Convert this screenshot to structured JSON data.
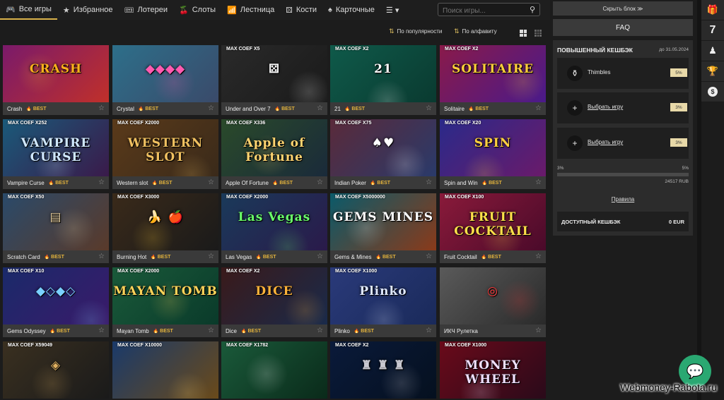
{
  "nav": {
    "items": [
      {
        "label": "Все игры",
        "icon": "gamepad-icon",
        "glyph": "🎮",
        "active": true
      },
      {
        "label": "Избранное",
        "icon": "star-icon",
        "glyph": "★"
      },
      {
        "label": "Лотереи",
        "icon": "ticket-icon",
        "glyph": "🎟"
      },
      {
        "label": "Слоты",
        "icon": "cherry-icon",
        "glyph": "🍒"
      },
      {
        "label": "Лестница",
        "icon": "ladder-icon",
        "glyph": "📶"
      },
      {
        "label": "Кости",
        "icon": "dice-icon",
        "glyph": "⚄"
      },
      {
        "label": "Карточные",
        "icon": "spade-icon",
        "glyph": "♠"
      }
    ],
    "more_glyph": "☰ ▾"
  },
  "search": {
    "placeholder": "Поиск игры...",
    "icon": "search-icon"
  },
  "sort": {
    "popular": "По популярности",
    "alphabet": "По алфавиту"
  },
  "games": [
    {
      "name": "Crash",
      "best": "BEST",
      "coef": "",
      "art": "CRASH",
      "bg": "#7a1a6a",
      "bg2": "#c0302a",
      "color": "#ffb21c"
    },
    {
      "name": "Crystal",
      "best": "BEST",
      "coef": "",
      "art": "◆◆◆◆",
      "bg": "#2d6f8a",
      "bg2": "#3a4a6a",
      "color": "#ff5ab0"
    },
    {
      "name": "Under and Over 7",
      "best": "BEST",
      "coef": "MAX COEF X5",
      "art": "⚄",
      "bg": "#2a2a2a",
      "bg2": "#1a1a1a",
      "color": "#f4f4f4"
    },
    {
      "name": "21",
      "best": "BEST",
      "coef": "MAX COEF X2",
      "art": "21",
      "bg": "#0f5a4a",
      "bg2": "#0a3a30",
      "color": "#ffffff"
    },
    {
      "name": "Solitaire",
      "best": "BEST",
      "coef": "MAX COEF X2",
      "art": "SOLITAIRE",
      "bg": "#8a1a4a",
      "bg2": "#4a1a8a",
      "color": "#ffcf3a"
    },
    {
      "name": "Vampire Curse",
      "best": "BEST",
      "coef": "MAX COEF X252",
      "art": "VAMPIRE CURSE",
      "bg": "#1a5a7a",
      "bg2": "#3a1a4a",
      "color": "#d0e8ff"
    },
    {
      "name": "Western slot",
      "best": "BEST",
      "coef": "MAX COEF X2000",
      "art": "WESTERN SLOT",
      "bg": "#5a3a1a",
      "bg2": "#3a2a1a",
      "color": "#f0c060"
    },
    {
      "name": "Apple Of Fortune",
      "best": "BEST",
      "coef": "MAX COEF X336",
      "art": "Apple of Fortune",
      "bg": "#2a4a2a",
      "bg2": "#1a2a3a",
      "color": "#ffd470"
    },
    {
      "name": "Indian Poker",
      "best": "BEST",
      "coef": "MAX COEF X75",
      "art": "♠♥",
      "bg": "#5a2a3a",
      "bg2": "#2a3a6a",
      "color": "#ffffff"
    },
    {
      "name": "Spin and Win",
      "best": "BEST",
      "coef": "MAX COEF X20",
      "art": "SPIN",
      "bg": "#2a2a8a",
      "bg2": "#6a1a6a",
      "color": "#ffd040"
    },
    {
      "name": "Scratch Card",
      "best": "BEST",
      "coef": "MAX COEF X50",
      "art": "▤",
      "bg": "#2a4a6a",
      "bg2": "#5a3a2a",
      "color": "#e8d0a0"
    },
    {
      "name": "Burning Hot",
      "best": "BEST",
      "coef": "MAX COEF X3000",
      "art": "🍌 🍎",
      "bg": "#3a2a1a",
      "bg2": "#1a1a1a",
      "color": "#ffcc33"
    },
    {
      "name": "Las Vegas",
      "best": "BEST",
      "coef": "MAX COEF X2000",
      "art": "Las Vegas",
      "bg": "#1a3a5a",
      "bg2": "#2a1a4a",
      "color": "#6aff6a"
    },
    {
      "name": "Gems & Mines",
      "best": "BEST",
      "coef": "MAX COEF X5000000",
      "art": "GEMS MINES",
      "bg": "#0a5a6a",
      "bg2": "#8a3a1a",
      "color": "#ffffff"
    },
    {
      "name": "Fruit Cocktail",
      "best": "BEST",
      "coef": "MAX COEF X100",
      "art": "FRUIT COCKTAIL",
      "bg": "#8a1a3a",
      "bg2": "#4a0a2a",
      "color": "#ffe04a"
    },
    {
      "name": "Gems Odyssey",
      "best": "BEST",
      "coef": "MAX COEF X10",
      "art": "◆◇◆◇",
      "bg": "#1a2a6a",
      "bg2": "#3a1a6a",
      "color": "#7ad0ff"
    },
    {
      "name": "Mayan Tomb",
      "best": "BEST",
      "coef": "MAX COEF X2000",
      "art": "MAYAN TOMB",
      "bg": "#1a5a3a",
      "bg2": "#0a3a2a",
      "color": "#ffd45a"
    },
    {
      "name": "Dice",
      "best": "BEST",
      "coef": "MAX COEF X2",
      "art": "DICE",
      "bg": "#3a1a1a",
      "bg2": "#1a2a4a",
      "color": "#ffb33a"
    },
    {
      "name": "Plinko",
      "best": "BEST",
      "coef": "MAX COEF X1000",
      "art": "Plinko",
      "bg": "#2a3a7a",
      "bg2": "#1a2a5a",
      "color": "#dfe8ff"
    },
    {
      "name": "ИКЧ Рулетка",
      "best": "",
      "coef": "",
      "art": "◎",
      "bg": "#5a5a5a",
      "bg2": "#2a2a2a",
      "color": "#ff3a3a"
    },
    {
      "name": "",
      "best": "",
      "coef": "MAX COEF X59049",
      "art": "◈",
      "bg": "#3a3020",
      "bg2": "#1a1a1a",
      "color": "#e0b060"
    },
    {
      "name": "",
      "best": "",
      "coef": "MAX COEF X10000",
      "art": "",
      "bg": "#1a3a6a",
      "bg2": "#6a4a1a",
      "color": "#ffd470"
    },
    {
      "name": "",
      "best": "",
      "coef": "MAX COEF X1782",
      "art": "",
      "bg": "#1a5a3a",
      "bg2": "#0a2a1a",
      "color": "#ffffff"
    },
    {
      "name": "",
      "best": "",
      "coef": "MAX COEF X2",
      "art": "♜ ♜ ♜",
      "bg": "#0a1a3a",
      "bg2": "#05101f",
      "color": "#c8c8d0"
    },
    {
      "name": "",
      "best": "",
      "coef": "MAX COEF X1000",
      "art": "MONEY WHEEL",
      "bg": "#6a0a1a",
      "bg2": "#2a0a1a",
      "color": "#f0e0ff"
    }
  ],
  "sidebar": {
    "hide_block": "Скрыть блок",
    "faq": "FAQ",
    "cashback": {
      "title": "ПОВЫШЕННЫЙ КЕШБЭК",
      "date": "до 31.05.2024",
      "rows": [
        {
          "label": "Thimbles",
          "pct": "5%",
          "icon": "thimbles-icon",
          "glyph": "⚱",
          "link": false
        },
        {
          "label": "Выбрать игру",
          "pct": "3%",
          "icon": "plus-icon",
          "glyph": "+",
          "link": true
        },
        {
          "label": "Выбрать игру",
          "pct": "3%",
          "icon": "plus-icon",
          "glyph": "+",
          "link": true
        }
      ],
      "progress_min": "3%",
      "progress_max": "5%",
      "progress_fraction": 0,
      "progress_amount": "24517 RUB",
      "rules": "Правила",
      "available_label": "ДОСТУПНЫЙ КЕШБЭК",
      "available_value": "0 EUR"
    }
  },
  "rail": [
    {
      "icon": "gift-icon",
      "glyph": "🎁"
    },
    {
      "icon": "seven-icon",
      "glyph": "7"
    },
    {
      "icon": "chess-pawn-icon",
      "glyph": "♟"
    },
    {
      "icon": "trophy-icon",
      "glyph": "🏆"
    },
    {
      "icon": "coin-icon",
      "glyph": "$"
    }
  ],
  "chat_icon": "chat-bubble-icon",
  "watermark": "Webmoney-Rabota.ru",
  "accent": "#d9b24a"
}
